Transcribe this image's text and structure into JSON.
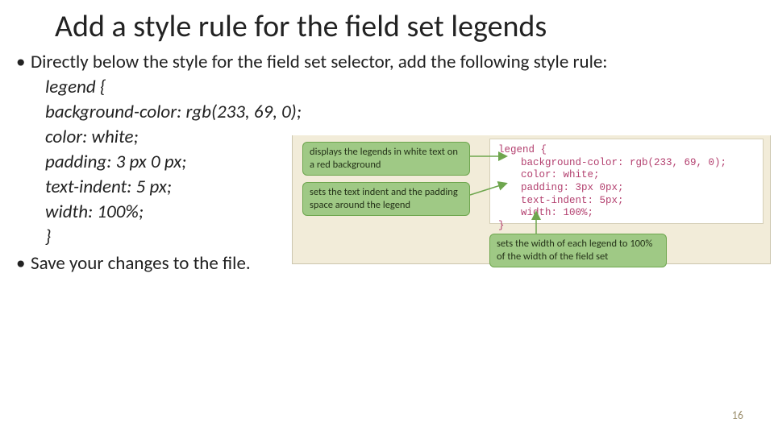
{
  "title": "Add a style rule for the field set legends",
  "bullet1": "Directly below the style for the field set selector, add the following style rule:",
  "code": {
    "l1": "legend {",
    "l2": "background-color: rgb(233, 69, 0);",
    "l3": "color: white;",
    "l4": "padding: 3 px 0 px;",
    "l5": "text-indent: 5 px;",
    "l6": "width: 100%;",
    "l7": "}"
  },
  "bullet2": "Save your changes to the file.",
  "pagenum": "16",
  "callouts": {
    "c1": "displays the legends in white text on a red background",
    "c2": "sets the text indent and the padding space around the legend",
    "c3": "sets the width of each legend to 100% of the width of the field set"
  },
  "codebox": {
    "l1": "legend {",
    "l2": "background-color: rgb(233, 69, 0);",
    "l3": "color: white;",
    "l4": "padding: 3px 0px;",
    "l5": "text-indent: 5px;",
    "l6": "width: 100%;",
    "l7": "}"
  }
}
